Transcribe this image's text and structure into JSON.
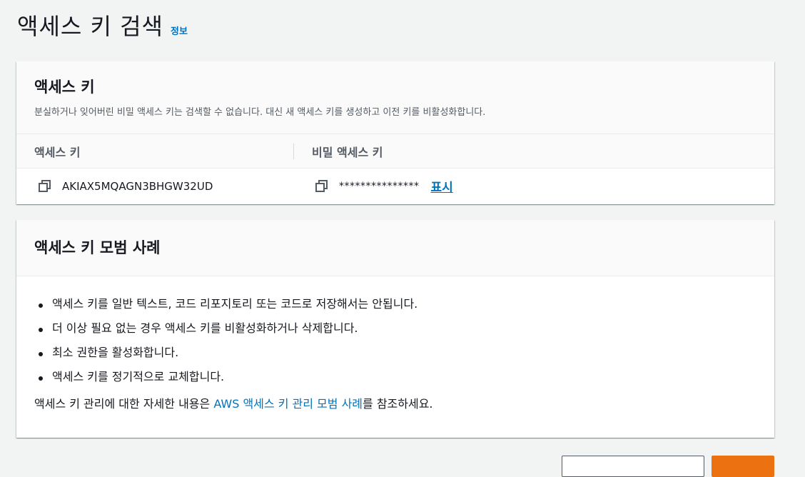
{
  "page": {
    "title": "액세스 키 검색",
    "info_link": "정보"
  },
  "access_keys_card": {
    "title": "액세스 키",
    "description": "분실하거나 잊어버린 비밀 액세스 키는 검색할 수 없습니다. 대신 새 액세스 키를 생성하고 이전 키를 비활성화합니다.",
    "columns": [
      "액세스 키",
      "비밀 액세스 키"
    ],
    "access_key_id": "AKIAX5MQAGN3BHGW32UD",
    "secret_masked": "***************",
    "show_label": "표시",
    "copy_icon": "copy-icon"
  },
  "best_practices_card": {
    "title": "액세스 키 모범 사례",
    "items": [
      "액세스 키를 일반 텍스트, 코드 리포지토리 또는 코드로 저장해서는 안됩니다.",
      "더 이상 필요 없는 경우 액세스 키를 비활성화하거나 삭제합니다.",
      "최소 권한을 활성화합니다.",
      "액세스 키를 정기적으로 교체합니다."
    ],
    "footnote_prefix": "액세스 키 관리에 대한 자세한 내용은 ",
    "footnote_link": "AWS 액세스 키 관리 모범 사례",
    "footnote_suffix": "를 참조하세요."
  },
  "colors": {
    "link": "#0073bb",
    "primary_button": "#ec7211",
    "background": "#f2f3f3"
  }
}
